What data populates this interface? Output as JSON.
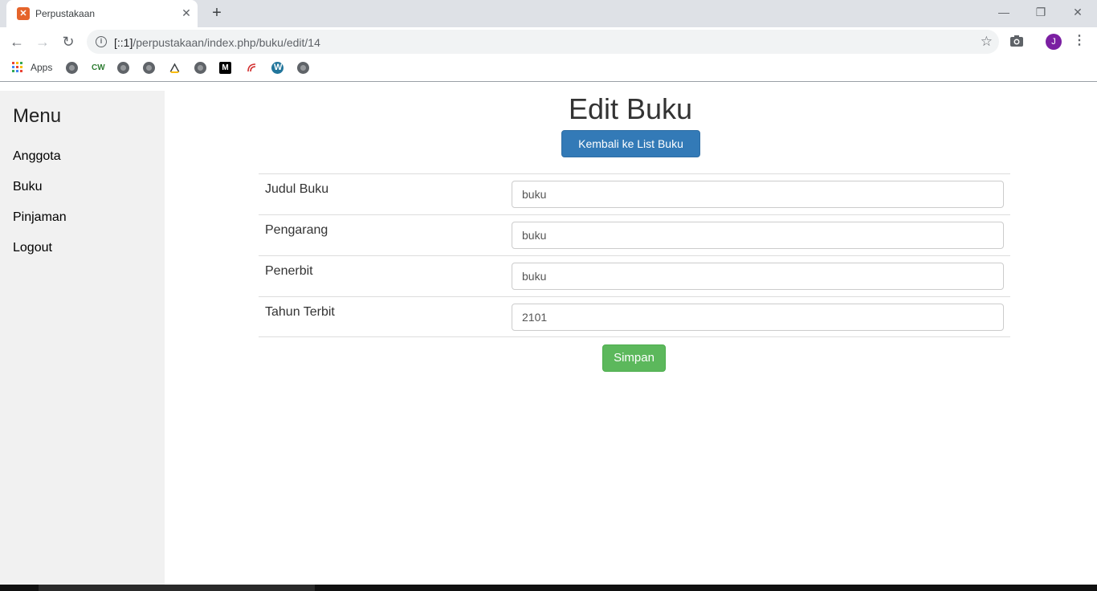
{
  "browser": {
    "tab_title": "Perpustakaan",
    "tab_close": "✕",
    "new_tab": "+",
    "url_host": "[::1]",
    "url_path": "/perpustakaan/index.php/buku/edit/14",
    "avatar_letter": "J",
    "bookmarks": {
      "apps_label": "Apps",
      "items": [
        {
          "icon": "globe-icon"
        },
        {
          "icon": "cw-icon",
          "text": "CW"
        },
        {
          "icon": "globe-icon"
        },
        {
          "icon": "globe-icon"
        },
        {
          "icon": "drive-icon"
        },
        {
          "icon": "globe-icon"
        },
        {
          "icon": "medium-icon",
          "text": "M"
        },
        {
          "icon": "curl-icon"
        },
        {
          "icon": "wordpress-icon"
        },
        {
          "icon": "globe-icon"
        }
      ]
    }
  },
  "sidebar": {
    "title": "Menu",
    "items": [
      {
        "label": "Anggota"
      },
      {
        "label": "Buku"
      },
      {
        "label": "Pinjaman"
      },
      {
        "label": "Logout"
      }
    ]
  },
  "main": {
    "title": "Edit Buku",
    "back_button": "Kembali ke List Buku",
    "fields": [
      {
        "label": "Judul Buku",
        "value": "buku"
      },
      {
        "label": "Pengarang",
        "value": "buku"
      },
      {
        "label": "Penerbit",
        "value": "buku"
      },
      {
        "label": "Tahun Terbit",
        "value": "2101"
      }
    ],
    "submit_button": "Simpan"
  },
  "colors": {
    "primary": "#337ab7",
    "success": "#5cb85c",
    "sidebar_bg": "#f1f1f1",
    "favicon": "#e5642b",
    "avatar": "#7b1fa2"
  }
}
